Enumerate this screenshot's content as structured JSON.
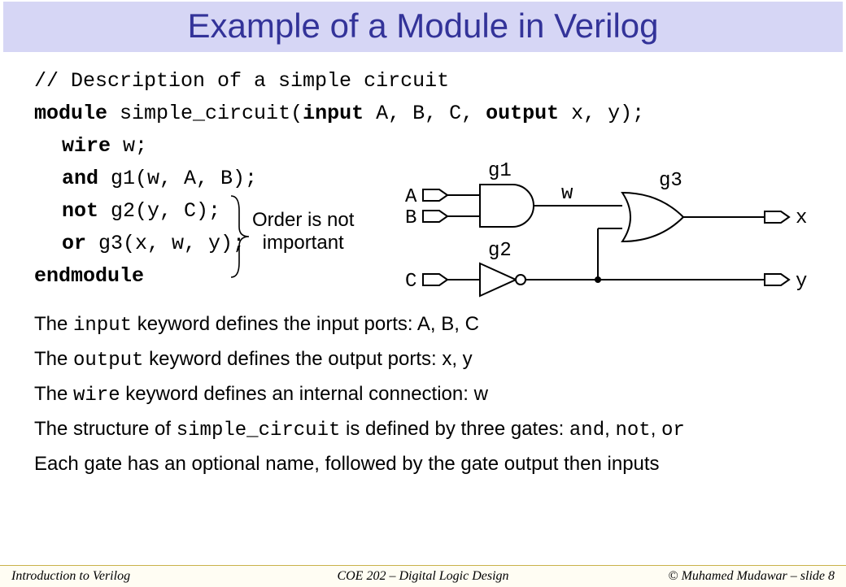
{
  "title": "Example of a Module in Verilog",
  "code": {
    "comment": "// Description of a simple circuit",
    "module_pre": "module ",
    "module_name": "simple_circuit(",
    "input_kw": "input",
    "input_args": " A, B, C, ",
    "output_kw": "output",
    "output_args": " x, y);",
    "wire_kw": "wire",
    "wire_rest": " w;",
    "and_kw": "and",
    "and_rest": " g1(w, A, B);",
    "not_kw": "not",
    "not_rest": " g2(y, C);",
    "or_kw": "or",
    "or_rest": "  g3(x, w, y);",
    "endmodule": "endmodule"
  },
  "order_note_l1": "Order is not",
  "order_note_l2": "important",
  "diagram": {
    "A": "A",
    "B": "B",
    "C": "C",
    "w": "w",
    "x": "x",
    "y": "y",
    "g1": "g1",
    "g2": "g2",
    "g3": "g3"
  },
  "explain1_pre": "The ",
  "explain1_code": "input",
  "explain1_post": " keyword defines the input ports: A, B, C",
  "explain2_pre": "The ",
  "explain2_code": "output",
  "explain2_post": " keyword defines the output ports: x, y",
  "explain3_pre": "The ",
  "explain3_code": "wire",
  "explain3_post": " keyword defines an internal connection: w",
  "explain4_pre": "The structure of ",
  "explain4_code": "simple_circuit",
  "explain4_mid": " is defined by three gates: ",
  "explain4_g1": "and",
  "explain4_s1": ", ",
  "explain4_g2": "not",
  "explain4_s2": ", ",
  "explain4_g3": "or",
  "explain5": "Each gate has an optional name, followed by the gate output then inputs",
  "footer": {
    "left": "Introduction to Verilog",
    "center": "COE 202 – Digital Logic Design",
    "right": "© Muhamed Mudawar – slide 8"
  }
}
